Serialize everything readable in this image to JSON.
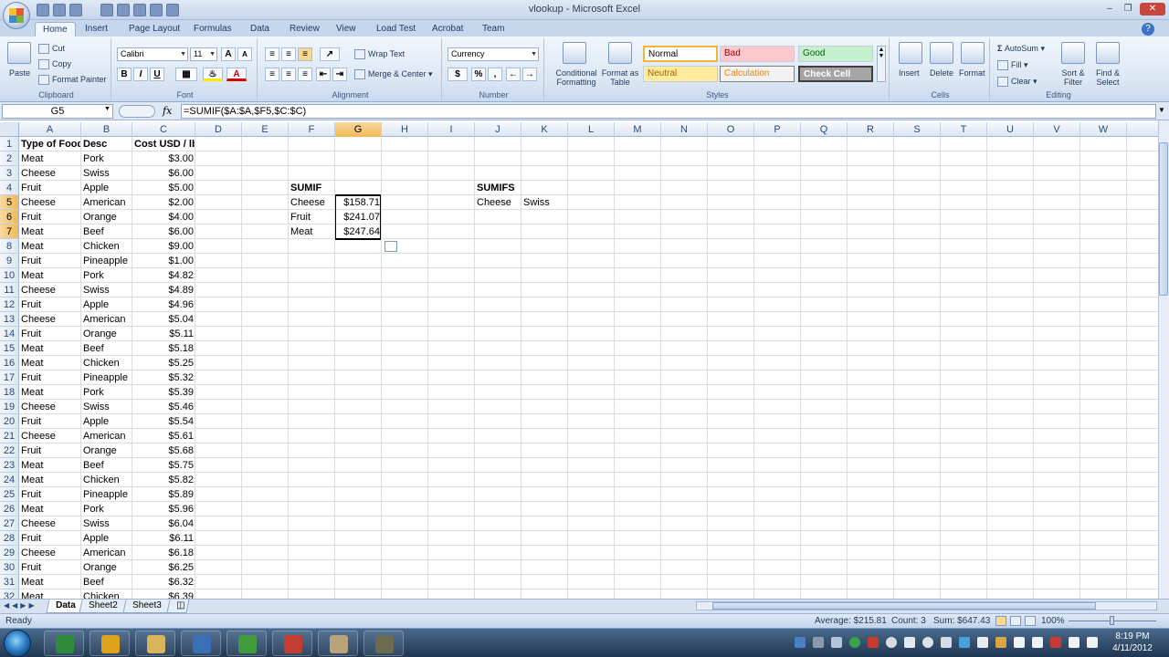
{
  "window": {
    "title": "vlookup - Microsoft Excel"
  },
  "tabs": [
    "Home",
    "Insert",
    "Page Layout",
    "Formulas",
    "Data",
    "Review",
    "View",
    "Load Test",
    "Acrobat",
    "Team"
  ],
  "ribbon": {
    "clipboard": {
      "label": "Clipboard",
      "paste": "Paste",
      "cut": "Cut",
      "copy": "Copy",
      "format_painter": "Format Painter"
    },
    "font": {
      "label": "Font",
      "name": "Calibri",
      "size": "11",
      "bold": "B",
      "italic": "I",
      "underline": "U"
    },
    "alignment": {
      "label": "Alignment",
      "wrap": "Wrap Text",
      "merge": "Merge & Center"
    },
    "number": {
      "label": "Number",
      "format": "Currency",
      "dollar": "$",
      "percent": "%",
      "comma": ","
    },
    "styles": {
      "label": "Styles",
      "conditional": "Conditional Formatting",
      "format_table": "Format as Table",
      "normal": "Normal",
      "bad": "Bad",
      "good": "Good",
      "neutral": "Neutral",
      "calculation": "Calculation",
      "check_cell": "Check Cell"
    },
    "cells": {
      "label": "Cells",
      "insert": "Insert",
      "delete": "Delete",
      "format": "Format"
    },
    "editing": {
      "label": "Editing",
      "autosum": "AutoSum",
      "fill": "Fill",
      "clear": "Clear",
      "sort": "Sort & Filter",
      "find": "Find & Select"
    }
  },
  "formula_bar": {
    "name_box": "G5",
    "fx": "fx",
    "formula": "=SUMIF($A:$A,$F5,$C:$C)"
  },
  "columns": [
    "A",
    "B",
    "C",
    "D",
    "E",
    "F",
    "G",
    "H",
    "I",
    "J",
    "K",
    "L",
    "M",
    "N",
    "O",
    "P",
    "Q",
    "R",
    "S",
    "T",
    "U",
    "V",
    "W"
  ],
  "selected_column": "G",
  "selected_rows": [
    5,
    6,
    7
  ],
  "rows": [
    {
      "n": "1",
      "a": "Type of Food",
      "b": "Desc",
      "c": "Cost USD / lb"
    },
    {
      "n": "2",
      "a": "Meat",
      "b": "Pork",
      "c": "$3.00"
    },
    {
      "n": "3",
      "a": "Cheese",
      "b": "Swiss",
      "c": "$6.00"
    },
    {
      "n": "4",
      "a": "Fruit",
      "b": "Apple",
      "c": "$5.00",
      "f": "SUMIF",
      "j": "SUMIFS"
    },
    {
      "n": "5",
      "a": "Cheese",
      "b": "American",
      "c": "$2.00",
      "f": "Cheese",
      "g": "$158.71",
      "j": "Cheese",
      "k": "Swiss"
    },
    {
      "n": "6",
      "a": "Fruit",
      "b": "Orange",
      "c": "$4.00",
      "f": "Fruit",
      "g": "$241.07"
    },
    {
      "n": "7",
      "a": "Meat",
      "b": "Beef",
      "c": "$6.00",
      "f": "Meat",
      "g": "$247.64"
    },
    {
      "n": "8",
      "a": "Meat",
      "b": "Chicken",
      "c": "$9.00"
    },
    {
      "n": "9",
      "a": "Fruit",
      "b": "Pineapple",
      "c": "$1.00"
    },
    {
      "n": "10",
      "a": "Meat",
      "b": "Pork",
      "c": "$4.82"
    },
    {
      "n": "11",
      "a": "Cheese",
      "b": "Swiss",
      "c": "$4.89"
    },
    {
      "n": "12",
      "a": "Fruit",
      "b": "Apple",
      "c": "$4.96"
    },
    {
      "n": "13",
      "a": "Cheese",
      "b": "American",
      "c": "$5.04"
    },
    {
      "n": "14",
      "a": "Fruit",
      "b": "Orange",
      "c": "$5.11"
    },
    {
      "n": "15",
      "a": "Meat",
      "b": "Beef",
      "c": "$5.18"
    },
    {
      "n": "16",
      "a": "Meat",
      "b": "Chicken",
      "c": "$5.25"
    },
    {
      "n": "17",
      "a": "Fruit",
      "b": "Pineapple",
      "c": "$5.32"
    },
    {
      "n": "18",
      "a": "Meat",
      "b": "Pork",
      "c": "$5.39"
    },
    {
      "n": "19",
      "a": "Cheese",
      "b": "Swiss",
      "c": "$5.46"
    },
    {
      "n": "20",
      "a": "Fruit",
      "b": "Apple",
      "c": "$5.54"
    },
    {
      "n": "21",
      "a": "Cheese",
      "b": "American",
      "c": "$5.61"
    },
    {
      "n": "22",
      "a": "Fruit",
      "b": "Orange",
      "c": "$5.68"
    },
    {
      "n": "23",
      "a": "Meat",
      "b": "Beef",
      "c": "$5.75"
    },
    {
      "n": "24",
      "a": "Meat",
      "b": "Chicken",
      "c": "$5.82"
    },
    {
      "n": "25",
      "a": "Fruit",
      "b": "Pineapple",
      "c": "$5.89"
    },
    {
      "n": "26",
      "a": "Meat",
      "b": "Pork",
      "c": "$5.96"
    },
    {
      "n": "27",
      "a": "Cheese",
      "b": "Swiss",
      "c": "$6.04"
    },
    {
      "n": "28",
      "a": "Fruit",
      "b": "Apple",
      "c": "$6.11"
    },
    {
      "n": "29",
      "a": "Cheese",
      "b": "American",
      "c": "$6.18"
    },
    {
      "n": "30",
      "a": "Fruit",
      "b": "Orange",
      "c": "$6.25"
    },
    {
      "n": "31",
      "a": "Meat",
      "b": "Beef",
      "c": "$6.32"
    },
    {
      "n": "32",
      "a": "Meat",
      "b": "Chicken",
      "c": "$6.39"
    }
  ],
  "sheets": [
    "Data",
    "Sheet2",
    "Sheet3"
  ],
  "active_sheet": "Data",
  "status": {
    "ready": "Ready",
    "average": "Average: $215.81",
    "count": "Count: 3",
    "sum": "Sum: $647.43",
    "zoom": "100%"
  },
  "clock": {
    "time": "8:19 PM",
    "date": "4/11/2012"
  },
  "taskbar_apps": [
    "excel-icon",
    "chrome-icon",
    "explorer-icon",
    "network-icon",
    "utorrent-icon",
    "mail-icon",
    "folder-icon",
    "media-icon"
  ]
}
